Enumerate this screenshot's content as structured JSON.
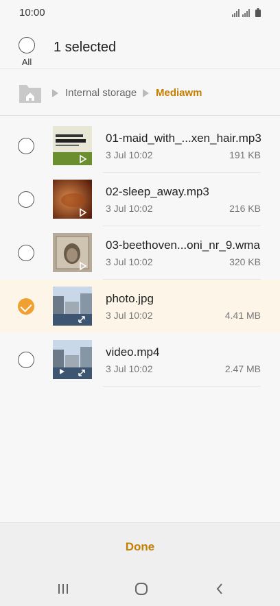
{
  "status_bar": {
    "time": "10:00"
  },
  "header": {
    "select_all_label": "All",
    "selected_count_text": "1 selected"
  },
  "breadcrumb": {
    "items": [
      "Internal storage",
      "Mediawm"
    ]
  },
  "files": [
    {
      "name": "01-maid_with_...xen_hair.mp3",
      "date": "3 Jul 10:02",
      "size": "191 KB",
      "selected": false,
      "type": "audio"
    },
    {
      "name": "02-sleep_away.mp3",
      "date": "3 Jul 10:02",
      "size": "216 KB",
      "selected": false,
      "type": "audio"
    },
    {
      "name": "03-beethoven...oni_nr_9.wma",
      "date": "3 Jul 10:02",
      "size": "320 KB",
      "selected": false,
      "type": "audio"
    },
    {
      "name": "photo.jpg",
      "date": "3 Jul 10:02",
      "size": "4.41 MB",
      "selected": true,
      "type": "image"
    },
    {
      "name": "video.mp4",
      "date": "3 Jul 10:02",
      "size": "2.47 MB",
      "selected": false,
      "type": "video"
    }
  ],
  "footer": {
    "done_label": "Done"
  },
  "colors": {
    "accent": "#c47e00",
    "check": "#f0a030",
    "selected_row": "#fdf6e8"
  },
  "icons": [
    "signal-icon",
    "battery-icon",
    "home-folder-icon",
    "play-icon",
    "expand-icon",
    "recents-icon",
    "home-icon",
    "back-icon"
  ]
}
